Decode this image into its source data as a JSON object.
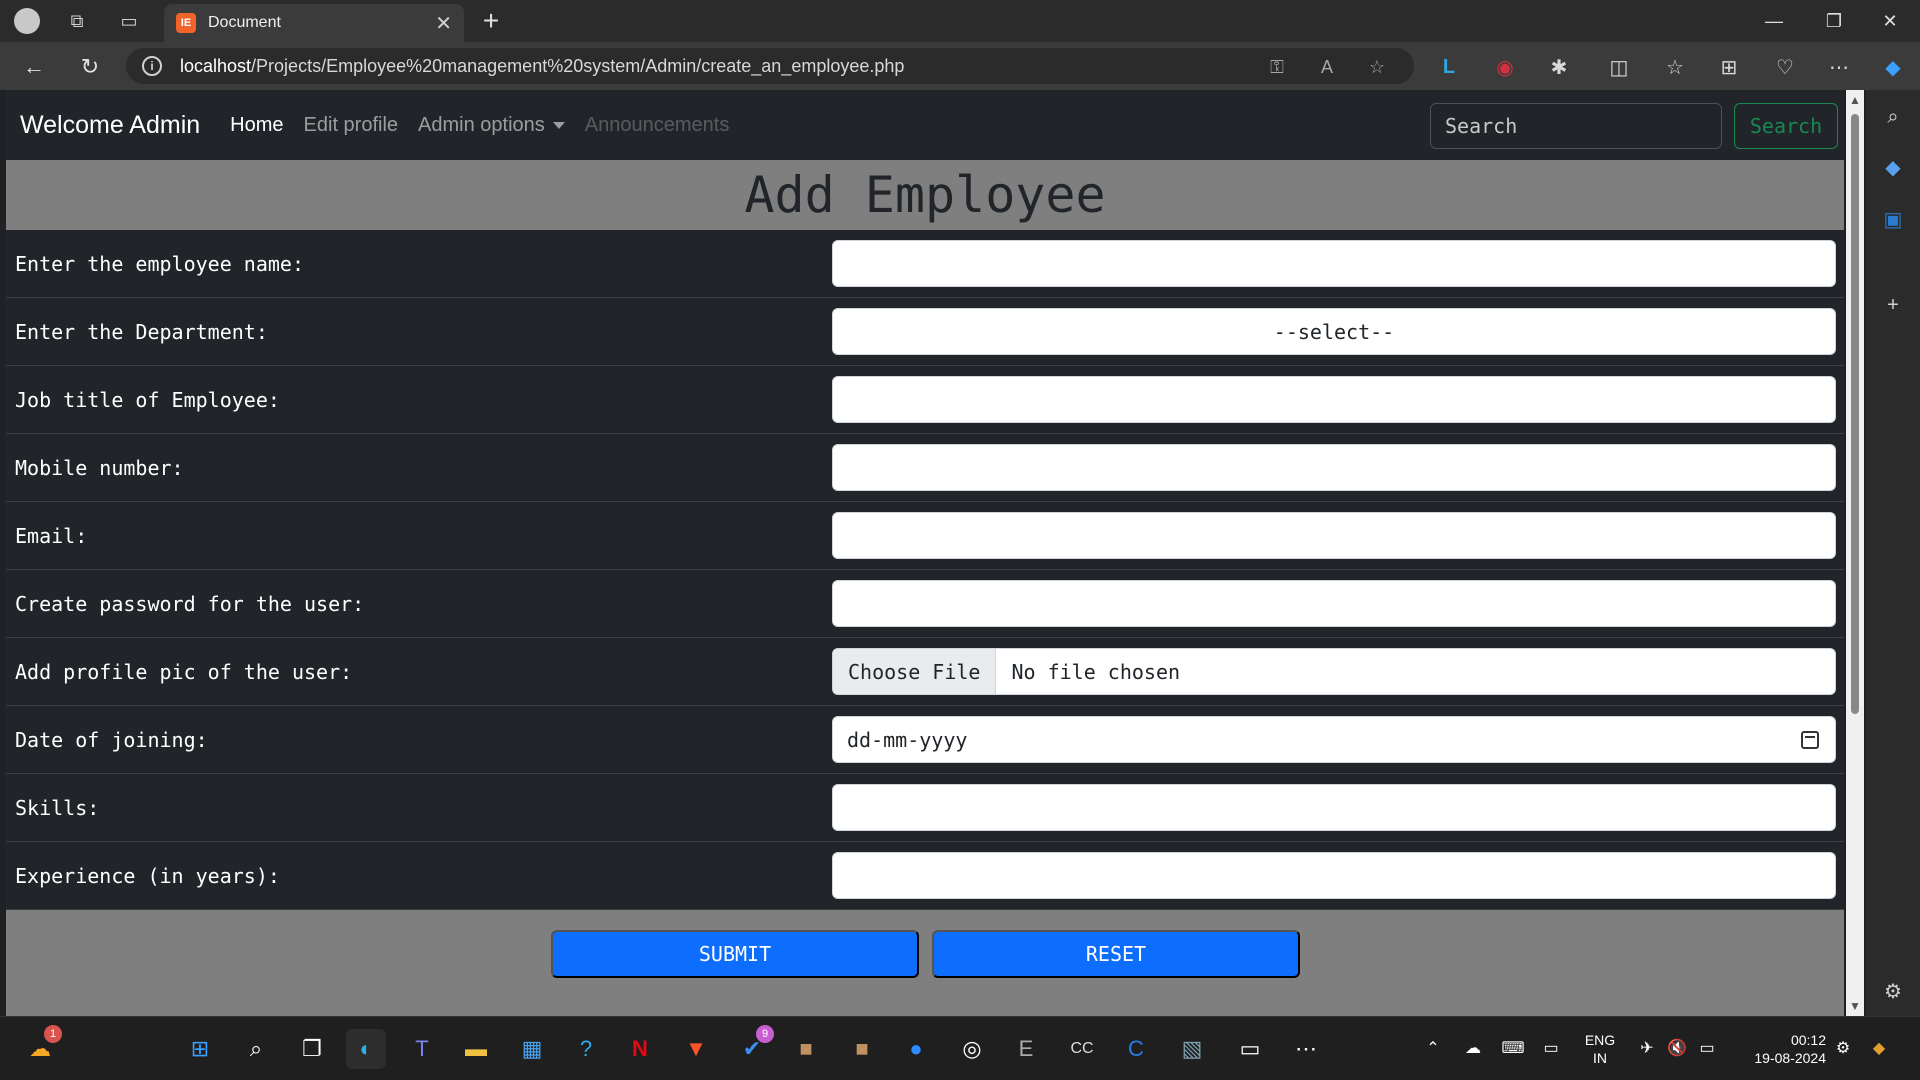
{
  "browser": {
    "tab_title": "Document",
    "favicon_text": "IE",
    "url_host": "localhost",
    "url_path": "/Projects/Employee%20management%20system/Admin/create_an_employee.php"
  },
  "navbar": {
    "brand": "Welcome Admin",
    "links": [
      {
        "label": "Home",
        "state": "active"
      },
      {
        "label": "Edit profile",
        "state": "normal"
      },
      {
        "label": "Admin options",
        "state": "dropdown"
      },
      {
        "label": "Announcements",
        "state": "disabled"
      }
    ],
    "search_placeholder": "Search",
    "search_button": "Search"
  },
  "page_title": "Add Employee",
  "form": {
    "rows": [
      {
        "label": "Enter the employee name:",
        "type": "text",
        "value": ""
      },
      {
        "label": "Enter the Department:",
        "type": "select",
        "value": "--select--"
      },
      {
        "label": "Job title of Employee:",
        "type": "text",
        "value": ""
      },
      {
        "label": "Mobile number:",
        "type": "text",
        "value": ""
      },
      {
        "label": "Email:",
        "type": "text",
        "value": ""
      },
      {
        "label": "Create password for the user:",
        "type": "text",
        "value": ""
      },
      {
        "label": "Add profile pic of the user:",
        "type": "file",
        "button": "Choose File",
        "value": "No file chosen"
      },
      {
        "label": "Date of joining:",
        "type": "date",
        "value": "dd-mm-yyyy"
      },
      {
        "label": "Skills:",
        "type": "text",
        "value": ""
      },
      {
        "label": "Experience (in years):",
        "type": "text",
        "value": ""
      }
    ],
    "submit_label": "SUBMIT",
    "reset_label": "RESET"
  },
  "taskbar": {
    "weather_badge": "1",
    "todo_badge": "9",
    "language": "ENG",
    "region": "IN",
    "time": "00:12",
    "date": "19-08-2024"
  },
  "colors": {
    "navbar_bg": "#212529",
    "page_bg": "#7f7f7f",
    "primary": "#0d6efd",
    "success": "#198754"
  }
}
